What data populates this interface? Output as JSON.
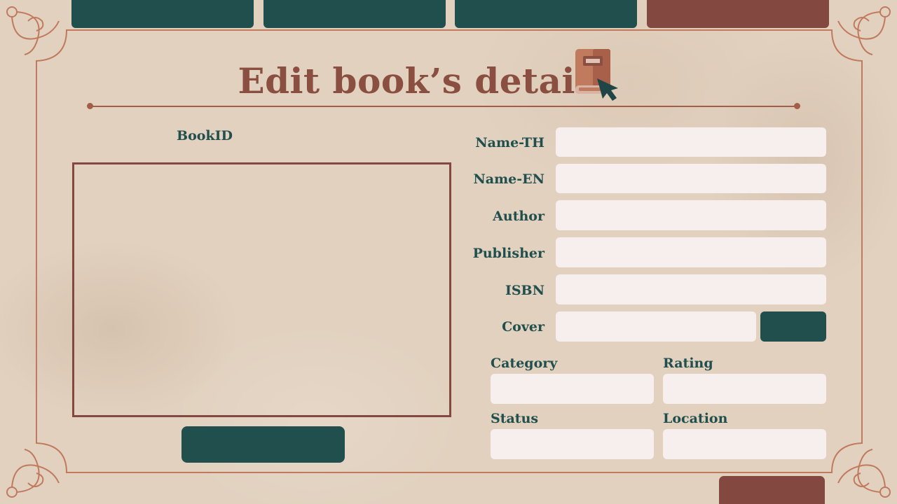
{
  "colors": {
    "background": "#e2d1bf",
    "accent_green": "#204f4e",
    "accent_red": "#834940",
    "title": "#8a4f40",
    "field": "#f7efee",
    "ornament": "#c07a5e"
  },
  "nav": {
    "tabs": [
      {
        "label": "",
        "color": "#204f4e"
      },
      {
        "label": "",
        "color": "#204f4e"
      },
      {
        "label": "",
        "color": "#204f4e"
      },
      {
        "label": "",
        "color": "#834940"
      }
    ]
  },
  "header": {
    "title": "Edit book’s detail",
    "icon": "book-cursor-icon"
  },
  "left": {
    "bookid_label": "BookID",
    "upload_button_label": ""
  },
  "form": {
    "name_th": {
      "label": "Name-TH",
      "value": ""
    },
    "name_en": {
      "label": "Name-EN",
      "value": ""
    },
    "author": {
      "label": "Author",
      "value": ""
    },
    "publisher": {
      "label": "Publisher",
      "value": ""
    },
    "isbn": {
      "label": "ISBN",
      "value": ""
    },
    "cover": {
      "label": "Cover",
      "value": "",
      "button_label": ""
    },
    "category": {
      "label": "Category",
      "value": ""
    },
    "rating": {
      "label": "Rating",
      "value": ""
    },
    "status": {
      "label": "Status",
      "value": ""
    },
    "location": {
      "label": "Location",
      "value": ""
    }
  },
  "footer": {
    "submit_button_label": ""
  }
}
